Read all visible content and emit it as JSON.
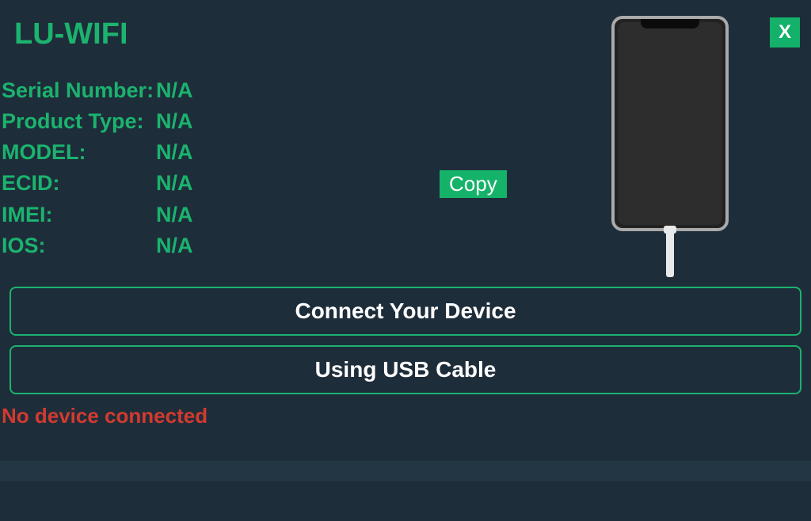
{
  "app": {
    "title": "LU-WIFI"
  },
  "info": {
    "serial_label": "Serial Number:",
    "serial_value": "N/A",
    "product_label": "Product Type:",
    "product_value": "N/A",
    "model_label": "MODEL:",
    "model_value": "N/A",
    "ecid_label": "ECID:",
    "ecid_value": "N/A",
    "imei_label": "IMEI:",
    "imei_value": "N/A",
    "ios_label": " IOS:",
    "ios_value": "N/A"
  },
  "actions": {
    "copy": "Copy",
    "close": "X",
    "connect": "Connect Your Device",
    "usb": "Using USB Cable"
  },
  "status": {
    "message": "No device connected"
  }
}
